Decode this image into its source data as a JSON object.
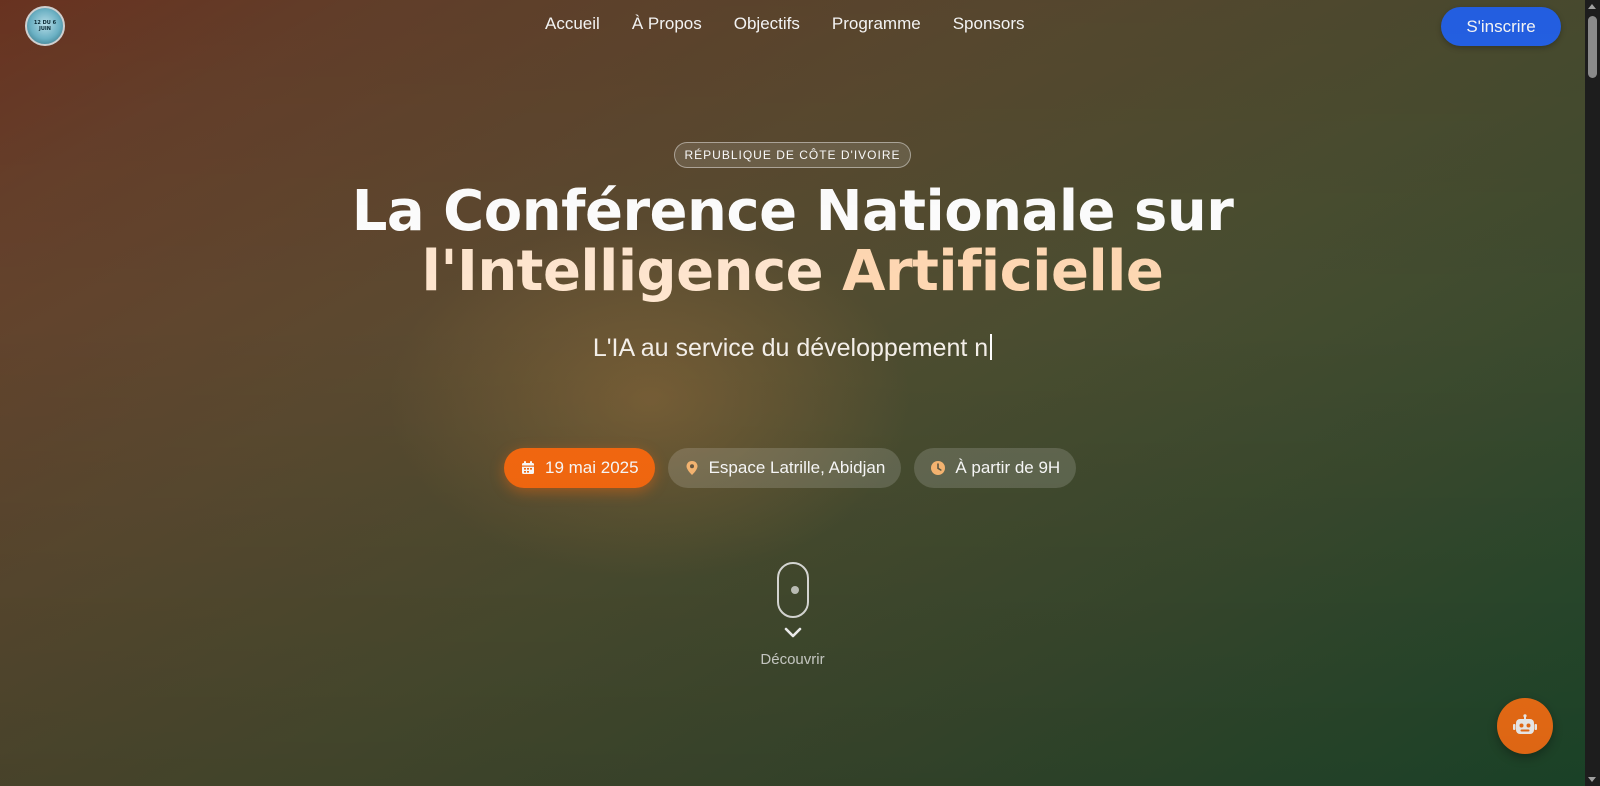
{
  "header": {
    "logo_text": "12 DU 6 JUIN",
    "nav": [
      "Accueil",
      "À Propos",
      "Objectifs",
      "Programme",
      "Sponsors"
    ],
    "cta_label": "S'inscrire"
  },
  "hero": {
    "badge": "RÉPUBLIQUE DE CÔTE D'IVOIRE",
    "title_line1": "La Conférence Nationale sur",
    "title_line2a": "l'Intelligence ",
    "title_line2b": "Artificielle",
    "subtitle": "L'IA au service du développement n",
    "chips": {
      "date": "19 mai 2025",
      "location": "Espace Latrille, Abidjan",
      "time": "À partir de 9H"
    },
    "discover": "Découvrir"
  },
  "icons": {
    "date": "calendar-icon",
    "location": "map-pin-icon",
    "time": "clock-icon",
    "fab": "robot-icon",
    "scroll": "chevron-down-icon"
  },
  "colors": {
    "accent_orange": "#f96a10",
    "cta_blue": "#2563eb",
    "title_highlight": "#ffd8b3"
  }
}
